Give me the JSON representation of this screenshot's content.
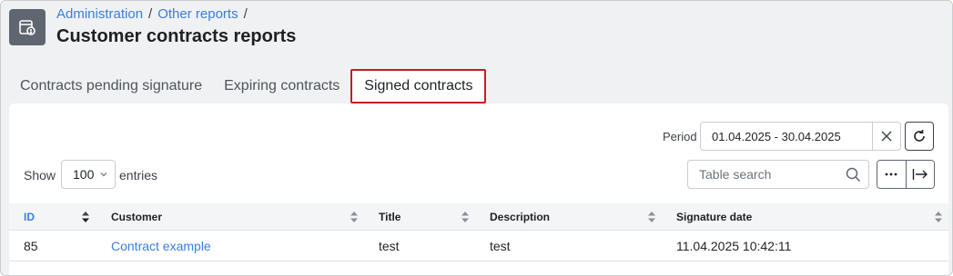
{
  "breadcrumb": {
    "items": [
      "Administration",
      "Other reports"
    ],
    "separator": "/"
  },
  "page": {
    "title": "Customer contracts reports",
    "icon": "report-document-icon"
  },
  "tabs": [
    {
      "label": "Contracts pending signature",
      "active": false
    },
    {
      "label": "Expiring contracts",
      "active": false
    },
    {
      "label": "Signed contracts",
      "active": true
    }
  ],
  "filters": {
    "period_label": "Period",
    "period_value": "01.04.2025 - 30.04.2025"
  },
  "entries": {
    "show_label": "Show",
    "value": "100",
    "suffix": "entries"
  },
  "search": {
    "placeholder": "Table search"
  },
  "table": {
    "columns": [
      {
        "label": "ID",
        "sorted": true
      },
      {
        "label": "Customer",
        "sorted": false
      },
      {
        "label": "Title",
        "sorted": false
      },
      {
        "label": "Description",
        "sorted": false
      },
      {
        "label": "Signature date",
        "sorted": false
      }
    ],
    "rows": [
      {
        "id": "85",
        "customer": "Contract example",
        "title": "test",
        "description": "test",
        "signature_date": "11.04.2025 10:42:11"
      }
    ]
  },
  "colors": {
    "accent": "#3b7ddd",
    "active_tab_border": "#c51d24"
  }
}
